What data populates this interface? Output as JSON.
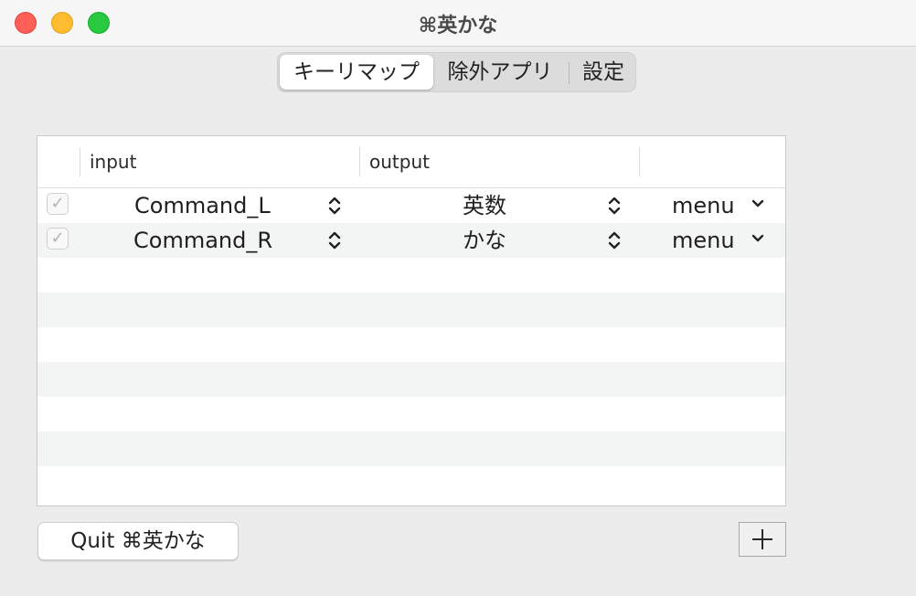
{
  "window": {
    "title": "⌘英かな"
  },
  "tabs": [
    {
      "label": "キーリマップ",
      "selected": true
    },
    {
      "label": "除外アプリ",
      "selected": false
    },
    {
      "label": "設定",
      "selected": false
    }
  ],
  "table": {
    "columns": [
      "",
      "input",
      "output",
      ""
    ],
    "rows": [
      {
        "enabled": true,
        "input": "Command_L",
        "output": "英数",
        "menu": "menu"
      },
      {
        "enabled": true,
        "input": "Command_R",
        "output": "かな",
        "menu": "menu"
      }
    ]
  },
  "footer": {
    "quit_label": "Quit ⌘英かな",
    "add_icon": "plus-icon"
  },
  "colors": {
    "close": "#fe5f57",
    "minimize": "#febc2e",
    "zoom": "#28c840",
    "row_alt": "#f3f4f4"
  }
}
